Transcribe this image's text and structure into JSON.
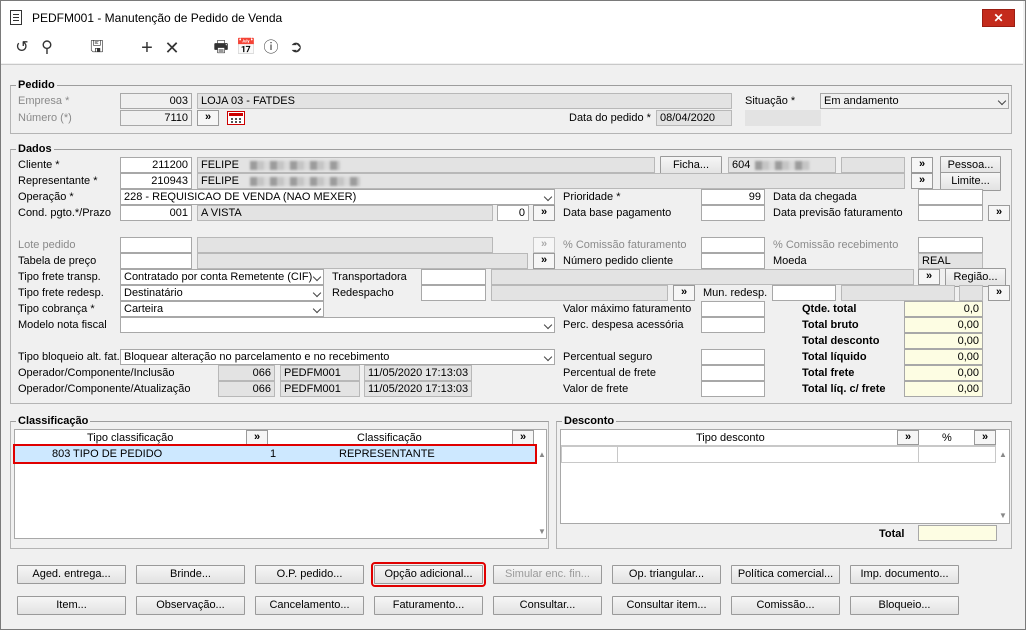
{
  "window": {
    "title": "PEDFM001 - Manutenção de Pedido de Venda",
    "close": "✕"
  },
  "toolbar": {
    "icons": [
      "refresh-icon",
      "search-icon",
      "save-icon",
      "add-icon",
      "delete-icon",
      "print-icon",
      "calendar-icon",
      "help-icon",
      "exit-icon"
    ]
  },
  "pedido": {
    "title": "Pedido",
    "empresa_label": "Empresa *",
    "empresa_code": "003",
    "empresa_name": "LOJA 03 - FATDES",
    "numero_label": "Número (*)",
    "numero": "7110",
    "data_label": "Data do pedido *",
    "data": "08/04/2020",
    "situacao_label": "Situação *",
    "situacao": "Em andamento"
  },
  "dados": {
    "title": "Dados",
    "cliente_label": "Cliente *",
    "cliente_code": "211200",
    "cliente_name": "FELIPE",
    "ficha_btn": "Ficha...",
    "cliente_phone": "604",
    "pessoa_btn": "Pessoa...",
    "rep_label": "Representante *",
    "rep_code": "210943",
    "rep_name": "FELIPE",
    "limite_btn": "Limite...",
    "operacao_label": "Operação *",
    "operacao": "228 - REQUISICAO DE VENDA (NAO MEXER)",
    "prioridade_label": "Prioridade *",
    "prioridade": "99",
    "data_chegada_label": "Data da chegada",
    "cond_label": "Cond. pgto.*/Prazo",
    "cond_code": "001",
    "cond_name": "A VISTA",
    "prazo": "0",
    "data_base_label": "Data base pagamento",
    "data_prev_label": "Data previsão faturamento",
    "lote_label": "Lote pedido",
    "comissao_fat_label": "% Comissão faturamento",
    "comissao_rec_label": "% Comissão recebimento",
    "tabela_label": "Tabela de preço",
    "num_cliente_label": "Número pedido cliente",
    "moeda_label": "Moeda",
    "moeda": "REAL",
    "frete_transp_label": "Tipo frete transp.",
    "frete_transp": "Contratado por conta Remetente (CIF)",
    "transportadora_label": "Transportadora",
    "regiao_btn": "Região...",
    "frete_redesp_label": "Tipo frete redesp.",
    "frete_redesp": "Destinatário",
    "redespacho_label": "Redespacho",
    "mun_redesp_label": "Mun. redesp.",
    "cobranca_label": "Tipo cobrança *",
    "cobranca": "Carteira",
    "valor_max_label": "Valor máximo faturamento",
    "modelo_label": "Modelo nota fiscal",
    "perc_desp_label": "Perc. despesa acessória",
    "bloqueio_label": "Tipo bloqueio alt. fat.",
    "bloqueio": "Bloquear alteração no parcelamento e no recebimento",
    "perc_seguro_label": "Percentual seguro",
    "op_inc_label": "Operador/Componente/Inclusão",
    "op_inc_code": "066",
    "op_inc_comp": "PEDFM001",
    "op_inc_date": "11/05/2020 17:13:03",
    "perc_frete_label": "Percentual de frete",
    "op_atu_label": "Operador/Componente/Atualização",
    "op_atu_code": "066",
    "op_atu_comp": "PEDFM001",
    "op_atu_date": "11/05/2020 17:13:03",
    "valor_frete_label": "Valor de frete",
    "totals": [
      {
        "label": "Qtde. total",
        "value": "0,0"
      },
      {
        "label": "Total bruto",
        "value": "0,00"
      },
      {
        "label": "Total desconto",
        "value": "0,00"
      },
      {
        "label": "Total líquido",
        "value": "0,00"
      },
      {
        "label": "Total frete",
        "value": "0,00"
      },
      {
        "label": "Total líq. c/ frete",
        "value": "0,00"
      }
    ]
  },
  "classificacao": {
    "title": "Classificação",
    "col_tipo": "Tipo classificação",
    "col_class": "Classificação",
    "rows": [
      {
        "code": "803",
        "tipo": "TIPO DE PEDIDO",
        "num": "1",
        "class": "REPRESENTANTE"
      }
    ]
  },
  "desconto": {
    "title": "Desconto",
    "col_tipo": "Tipo desconto",
    "col_pct": "%",
    "total_label": "Total"
  },
  "buttons_row1": [
    "Aged. entrega...",
    "Brinde...",
    "O.P. pedido...",
    "Opção adicional...",
    "Simular enc. fin...",
    "Op. triangular...",
    "Política comercial...",
    "Imp. documento..."
  ],
  "buttons_row2": [
    "Item...",
    "Observação...",
    "Cancelamento...",
    "Faturamento...",
    "Consultar...",
    "Consultar item...",
    "Comissão...",
    "Bloqueio..."
  ],
  "arrow": "»"
}
